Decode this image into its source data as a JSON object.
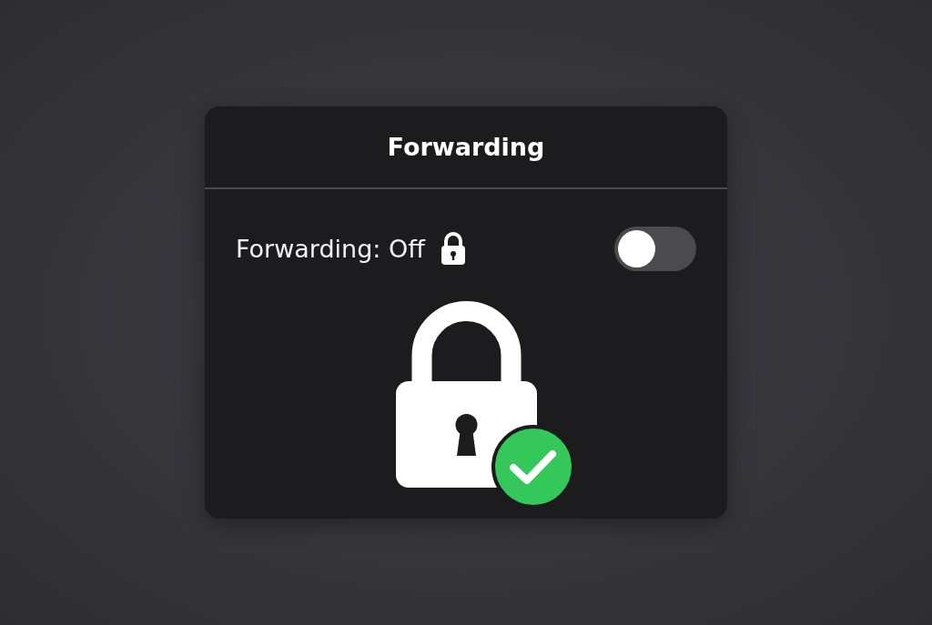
{
  "dialog": {
    "title": "Forwarding"
  },
  "setting": {
    "label": "Forwarding: Off",
    "on": false
  }
}
